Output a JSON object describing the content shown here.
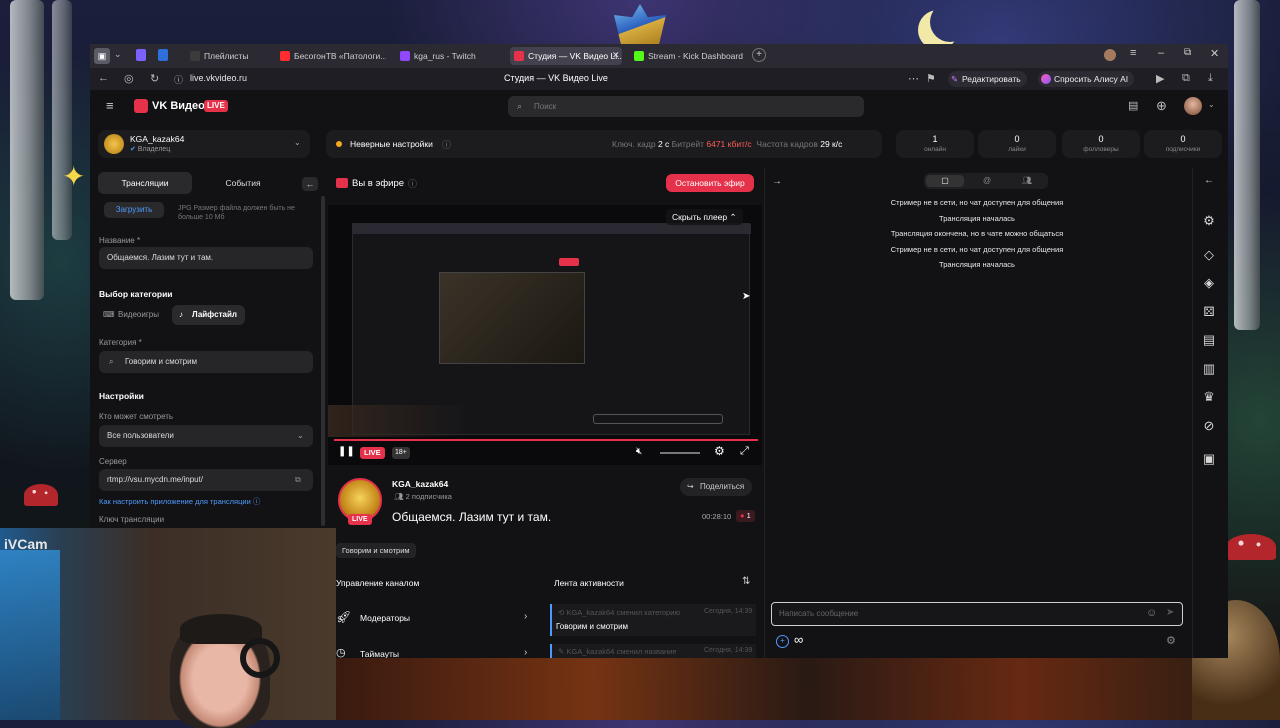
{
  "browser": {
    "tabs": [
      {
        "label": "Плейлисты"
      },
      {
        "label": "БесогонТВ «Патологи..."
      },
      {
        "label": "kga_rus - Twitch"
      },
      {
        "label": "Студия — VK Видео Li..."
      },
      {
        "label": "Stream - Kick Dashboard"
      }
    ],
    "url": "live.vkvideo.ru",
    "page_title": "Студия — VK Видео Live",
    "edit_label": "Редактировать",
    "alice_label": "Спросить Алису AI"
  },
  "header": {
    "logo_text": "VK Видео",
    "logo_badge": "LIVE",
    "search_placeholder": "Поиск"
  },
  "channel": {
    "name": "KGA_kazak64",
    "role": "Владелец"
  },
  "status_bar": {
    "warning": "Неверные настройки",
    "keyframe_label": "Ключ. кадр",
    "keyframe_value": "2 с",
    "bitrate_label": "Битрейт",
    "bitrate_value": "6471 кбит/с",
    "fps_label": "Частота кадров",
    "fps_value": "29 к/с"
  },
  "stats": [
    {
      "value": "1",
      "label": "онлайн"
    },
    {
      "value": "0",
      "label": "лайки"
    },
    {
      "value": "0",
      "label": "фолловеры"
    },
    {
      "value": "0",
      "label": "подписчики"
    }
  ],
  "left_panel": {
    "tab_broadcasts": "Трансляции",
    "tab_events": "События",
    "upload_button": "Загрузить",
    "upload_hint": "JPG Размер файла должен быть не больше 10 Мб",
    "title_label": "Название *",
    "title_value": "Общаемся. Лазим тут и там.",
    "category_select_label": "Выбор категории",
    "cat_games": "Видеоигры",
    "cat_lifestyle": "Лайфстайл",
    "category_label": "Категория *",
    "category_value": "Говорим и смотрим",
    "settings_label": "Настройки",
    "who_can_watch_label": "Кто может смотреть",
    "who_can_watch_value": "Все пользователи",
    "server_label": "Сервер",
    "server_value": "rtmp://vsu.mycdn.me/input/",
    "setup_link": "Как настроить приложение для трансляции",
    "key_label": "Ключ трансляции"
  },
  "center": {
    "on_air_label": "Вы в эфире",
    "stop_button": "Остановить эфир",
    "hide_player": "Скрыть плеер",
    "live_badge": "LIVE",
    "age_badge": "18+",
    "streamer_name": "KGA_kazak64",
    "subscribers": "2 подписчика",
    "share_button": "Поделиться",
    "stream_title": "Общаемся. Лазим тут и там.",
    "duration": "00:28:10",
    "viewers": "1",
    "category_tag": "Говорим и смотрим",
    "avatar_live": "LIVE",
    "manage_title": "Управление каналом",
    "manage_items": [
      "Модераторы",
      "Таймауты"
    ],
    "activity_title": "Лента активности",
    "activity_items": [
      {
        "user": "KGA_kazak64",
        "action": "сменил категорию",
        "time": "Сегодня, 14:39",
        "detail": "Говорим и смотрим"
      },
      {
        "user": "KGA_kazak64",
        "action": "сменил название",
        "time": "Сегодня, 14:39",
        "detail": ""
      }
    ]
  },
  "chat": {
    "messages": [
      "Стример не в сети, но чат доступен для общения",
      "Трансляция началась",
      "Трансляция окончена, но в чате можно общаться",
      "Стример не в сети, но чат доступен для общения",
      "Трансляция началась"
    ],
    "input_placeholder": "Написать сообщение",
    "infinity": "∞"
  },
  "webcam": {
    "label": "iVCam"
  },
  "colors": {
    "accent_red": "#e5324a",
    "status_orange": "#f5a623",
    "bitrate_red": "#ff5c5c",
    "link_blue": "#4d9bff"
  }
}
